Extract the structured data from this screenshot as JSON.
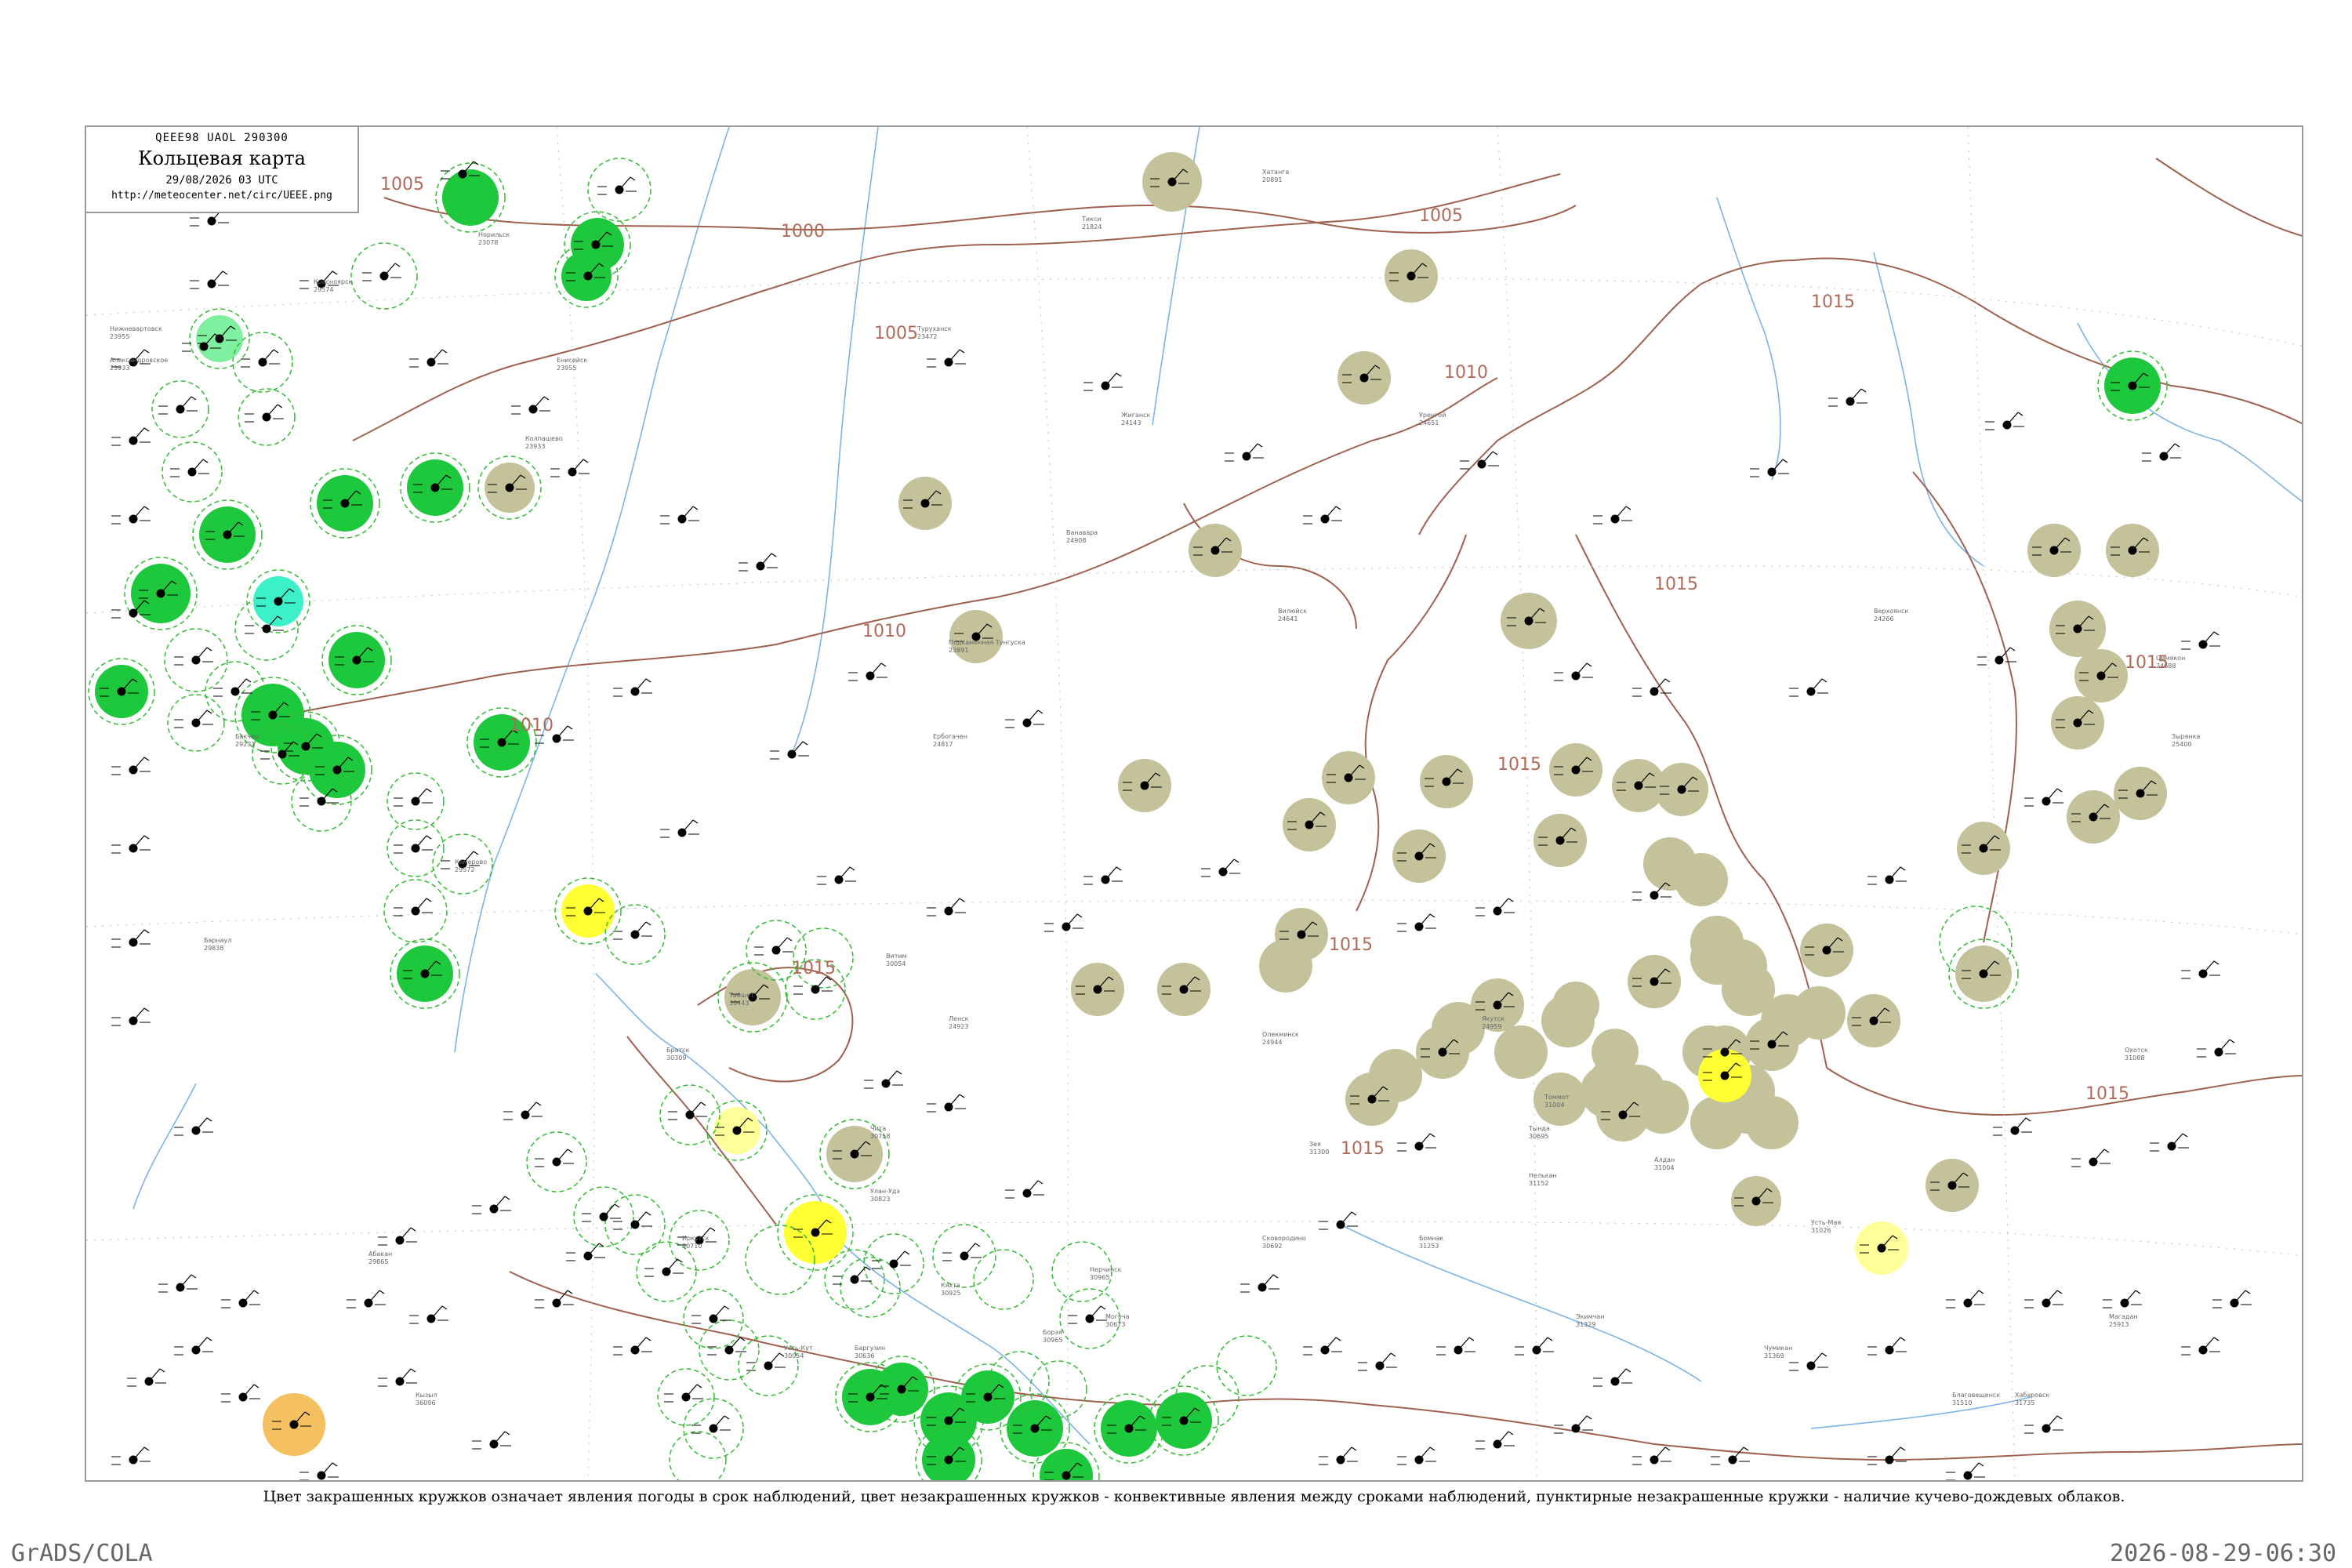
{
  "header": {
    "code": "QEEE98  UAOL  290300",
    "title": "Кольцевая карта",
    "datetime": "29/08/2026 03 UTC",
    "url": "http://meteocenter.net/circ/UEEE.png"
  },
  "caption": "Цвет закрашенных кружков означает явления погоды в срок наблюдений, цвет незакрашенных кружков - конвективные явления между сроками наблюдений, пунктирные незакрашенные кружки - наличие кучево-дождевых облаков.",
  "footer": {
    "left": "GrADS/COLA",
    "right": "2026-08-29-06:30"
  },
  "colors": {
    "green": "#1ec83c",
    "olive": "#c4c29a",
    "yellow": "#ffff33",
    "light_yellow": "#ffff99",
    "cyan": "#3cf0c8",
    "light_green": "#7ef0a0",
    "orange": "#f5c060",
    "isobar": "#a06050",
    "river": "#7ab4e8",
    "dashed_ring": "#33bb33"
  },
  "isobar_labels": [
    "1000",
    "1005",
    "1005",
    "1005",
    "1010",
    "1010",
    "1010",
    "1015",
    "1015",
    "1015",
    "1015",
    "1015",
    "1015",
    "1015",
    "1015"
  ],
  "stations": [
    {
      "name": "Нижневартовск",
      "id": "23955"
    },
    {
      "name": "Александровское",
      "id": "23933"
    },
    {
      "name": "Бакчар",
      "id": "29231"
    },
    {
      "name": "Колпашево",
      "id": "23933"
    },
    {
      "name": "Уренгой",
      "id": "24651"
    },
    {
      "name": "Усть-Кут",
      "id": "30054"
    },
    {
      "name": "Тайшет",
      "id": "30443"
    },
    {
      "name": "Кемерово",
      "id": "29572"
    },
    {
      "name": "Барнаул",
      "id": "29838"
    },
    {
      "name": "Абакан",
      "id": "29865"
    },
    {
      "name": "Кызыл",
      "id": "36096"
    },
    {
      "name": "Иркутск",
      "id": "30710"
    },
    {
      "name": "Улан-Удэ",
      "id": "30823"
    },
    {
      "name": "Чита",
      "id": "30758"
    },
    {
      "name": "Братск",
      "id": "30309"
    },
    {
      "name": "Витим",
      "id": "30054"
    },
    {
      "name": "Ленск",
      "id": "24923"
    },
    {
      "name": "Олекминск",
      "id": "24944"
    },
    {
      "name": "Якутск",
      "id": "24959"
    },
    {
      "name": "Томмот",
      "id": "31004"
    },
    {
      "name": "Алдан",
      "id": "31004"
    },
    {
      "name": "Оймякон",
      "id": "24688"
    },
    {
      "name": "Верхоянск",
      "id": "24266"
    },
    {
      "name": "Зырянка",
      "id": "25400"
    },
    {
      "name": "Усть-Мая",
      "id": "31026"
    },
    {
      "name": "Охотск",
      "id": "31088"
    },
    {
      "name": "Магадан",
      "id": "25913"
    },
    {
      "name": "Тында",
      "id": "30695"
    },
    {
      "name": "Благовещенск",
      "id": "31510"
    },
    {
      "name": "Хабаровск",
      "id": "31735"
    },
    {
      "name": "Нерчинск",
      "id": "30965"
    },
    {
      "name": "Борзя",
      "id": "30965"
    },
    {
      "name": "Кяхта",
      "id": "30925"
    },
    {
      "name": "Баргузин",
      "id": "30636"
    },
    {
      "name": "Могоча",
      "id": "30673"
    },
    {
      "name": "Сковородино",
      "id": "30692"
    },
    {
      "name": "Зея",
      "id": "31300"
    },
    {
      "name": "Бомнак",
      "id": "31253"
    },
    {
      "name": "Экимчан",
      "id": "31329"
    },
    {
      "name": "Чумикан",
      "id": "31369"
    },
    {
      "name": "Нелькан",
      "id": "31152"
    },
    {
      "name": "Тикси",
      "id": "21824"
    },
    {
      "name": "Жиганск",
      "id": "24143"
    },
    {
      "name": "Вилюйск",
      "id": "24641"
    },
    {
      "name": "Туруханск",
      "id": "23472"
    },
    {
      "name": "Подкаменная Тунгуска",
      "id": "23891"
    },
    {
      "name": "Ванавара",
      "id": "24908"
    },
    {
      "name": "Ербогачен",
      "id": "24817"
    },
    {
      "name": "Енисейск",
      "id": "23955"
    },
    {
      "name": "Красноярск",
      "id": "29574"
    },
    {
      "name": "Хатанга",
      "id": "20891"
    },
    {
      "name": "Норильск",
      "id": "23078"
    }
  ]
}
